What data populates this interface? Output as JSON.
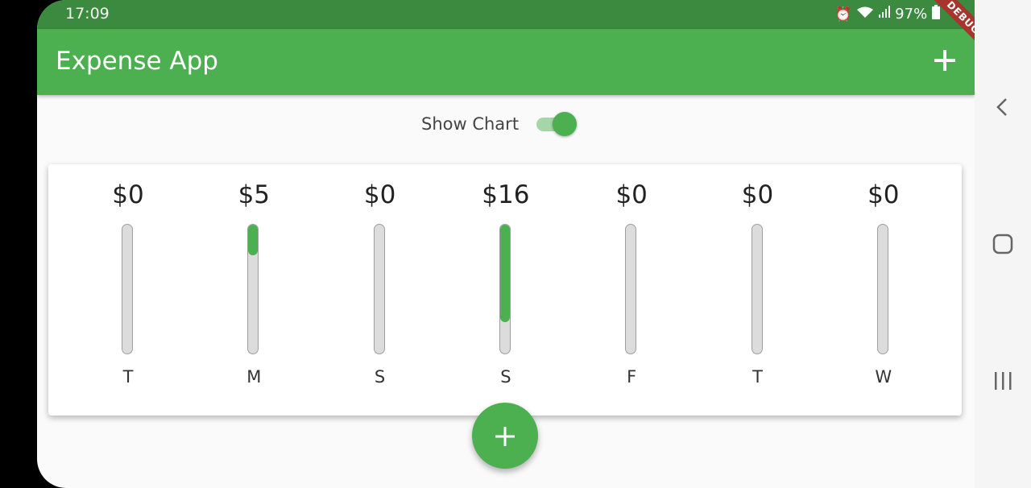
{
  "status_bar": {
    "time": "17:09",
    "battery": "97%"
  },
  "app_bar": {
    "title": "Expense App",
    "add_action_icon": "plus-icon",
    "debug_banner": "DEBUG"
  },
  "toggle": {
    "label": "Show Chart",
    "value": true
  },
  "chart_data": {
    "type": "bar",
    "categories": [
      "T",
      "M",
      "S",
      "S",
      "F",
      "T",
      "W"
    ],
    "amount_labels": [
      "$0",
      "$5",
      "$0",
      "$16",
      "$0",
      "$0",
      "$0"
    ],
    "values": [
      0,
      5,
      0,
      16,
      0,
      0,
      0
    ],
    "fill_fractions": [
      0,
      0.24,
      0,
      0.76,
      0,
      0,
      0
    ]
  },
  "fab": {
    "icon": "plus-icon"
  },
  "navigation": {
    "back_icon": "back-icon",
    "home_icon": "home-icon",
    "recents_icon": "recents-icon"
  },
  "colors": {
    "primary": "#4caf50",
    "status_bar": "#3b8a40",
    "track": "#dcdcdc"
  }
}
